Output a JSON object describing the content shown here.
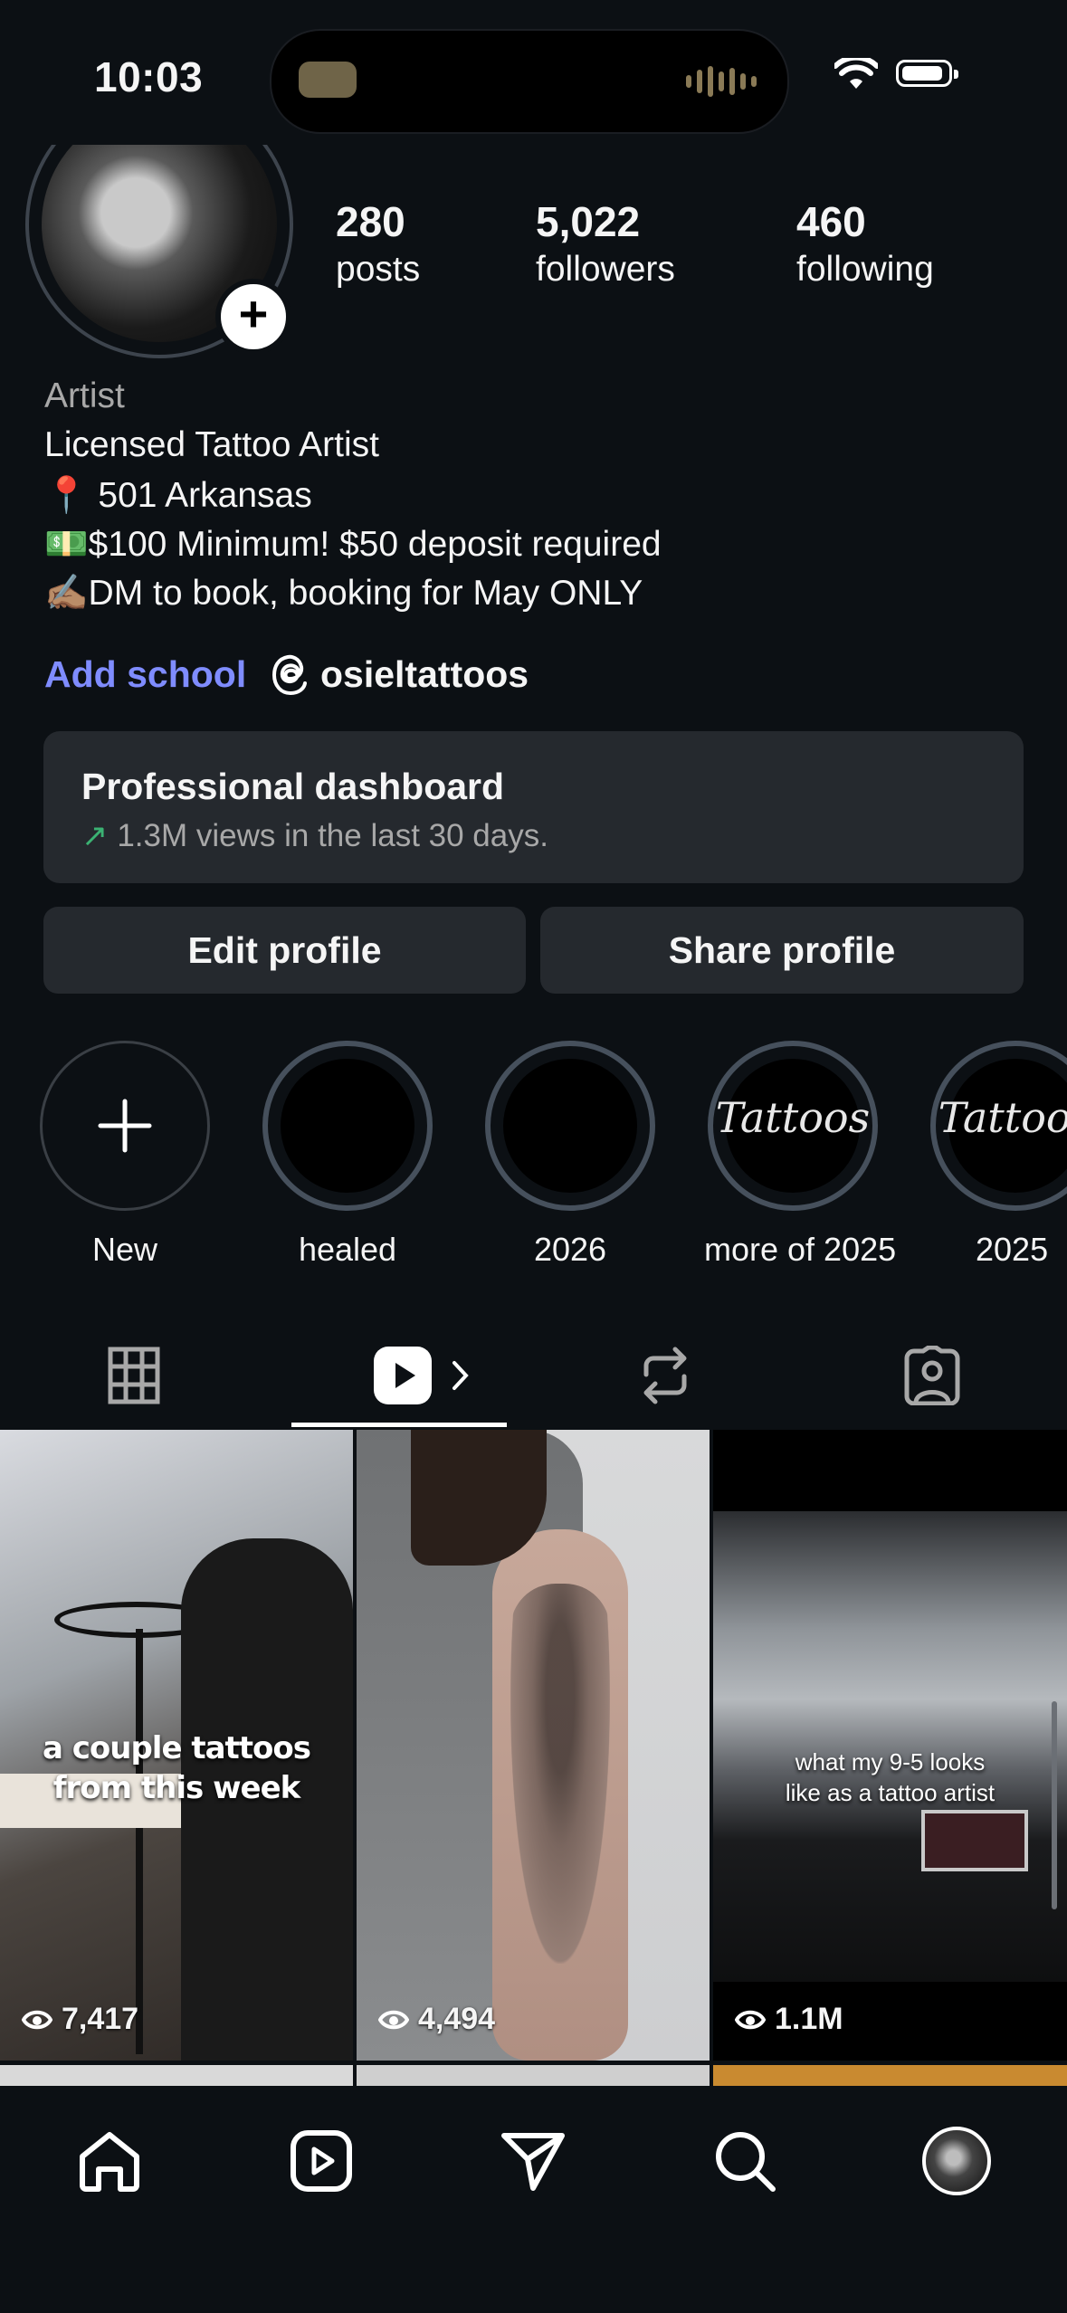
{
  "status_bar": {
    "time": "10:03"
  },
  "profile": {
    "stats": [
      {
        "value": "280",
        "label": "posts"
      },
      {
        "value": "5,022",
        "label": "followers"
      },
      {
        "value": "460",
        "label": "following"
      }
    ],
    "category": "Artist",
    "bio": [
      "Licensed Tattoo Artist",
      "📍 501 Arkansas",
      "💵$100 Minimum! $50 deposit required",
      "✍🏽DM to book, booking for May ONLY"
    ],
    "add_school": "Add school",
    "threads_handle": "osieltattoos"
  },
  "dashboard": {
    "title": "Professional dashboard",
    "subtitle": "1.3M views in the last 30 days."
  },
  "buttons": {
    "edit": "Edit profile",
    "share": "Share profile"
  },
  "highlights": [
    {
      "label": "New"
    },
    {
      "label": "healed"
    },
    {
      "label": "2026"
    },
    {
      "label": "more of 2025",
      "cover_text": "Tattoos"
    },
    {
      "label": "2025",
      "cover_text": "Tattoos"
    }
  ],
  "tabs": [
    "grid-icon",
    "reels-icon",
    "reposts-icon",
    "tagged-icon"
  ],
  "reels": [
    {
      "caption": "a couple tattoos from this week",
      "views": "7,417"
    },
    {
      "caption": "",
      "views": "4,494"
    },
    {
      "caption": "what my 9-5 looks like as a tattoo artist",
      "views": "1.1M"
    }
  ],
  "nav": [
    "home-icon",
    "reels-icon",
    "messages-icon",
    "search-icon",
    "profile-avatar"
  ],
  "colors": {
    "background": "#0c1014",
    "card": "#25292e",
    "link": "#7f8cff",
    "trend": "#3bb273"
  }
}
